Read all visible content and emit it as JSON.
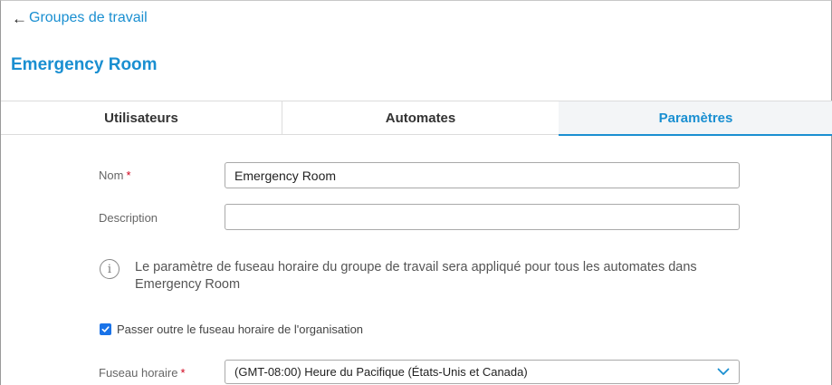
{
  "nav": {
    "back_arrow": "←",
    "back_label": "Groupes de travail"
  },
  "page": {
    "title": "Emergency Room"
  },
  "tabs": [
    {
      "label": "Utilisateurs",
      "active": false
    },
    {
      "label": "Automates",
      "active": false
    },
    {
      "label": "Paramètres",
      "active": true
    }
  ],
  "form": {
    "name": {
      "label": "Nom",
      "required_mark": "*",
      "value": "Emergency Room"
    },
    "description": {
      "label": "Description",
      "value": "",
      "placeholder": ""
    },
    "info": {
      "icon": "info-icon",
      "glyph": "i",
      "text": "Le paramètre de fuseau horaire du groupe de travail sera appliqué pour tous les automates dans Emergency Room"
    },
    "override": {
      "checked": true,
      "label": "Passer outre le fuseau horaire de l'organisation"
    },
    "timezone": {
      "label": "Fuseau horaire",
      "required_mark": "*",
      "selected": "(GMT-08:00) Heure du Pacifique (États-Unis et Canada)"
    }
  },
  "colors": {
    "accent": "#1a8fd1",
    "required": "#d0021b",
    "checkbox": "#1a73e8"
  }
}
